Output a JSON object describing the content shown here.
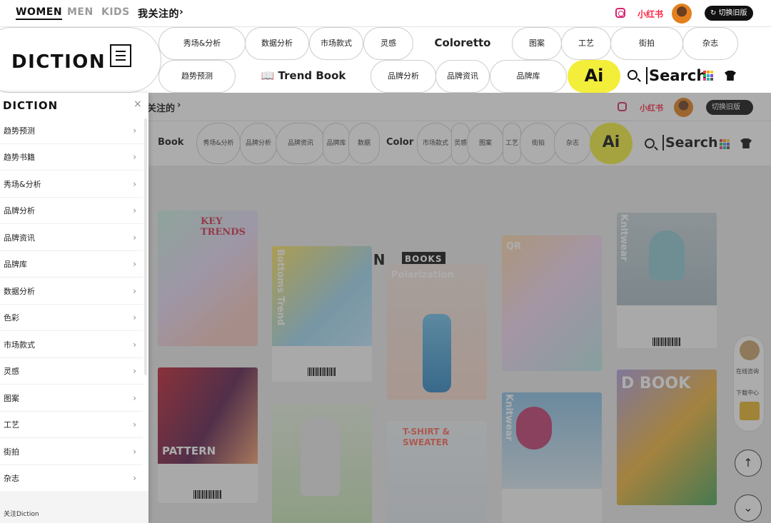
{
  "topbar": {
    "nav": [
      "WOMEN",
      "MEN",
      "KIDS"
    ],
    "following": "我关注的",
    "xiaohongshu": "小红书",
    "old_version": "切换旧版"
  },
  "header": {
    "logo": "DICTION",
    "pills_row1": [
      "秀场&分析",
      "数据分析",
      "市场款式",
      "灵感",
      "图案",
      "工艺",
      "街拍",
      "杂志"
    ],
    "coloretto": "Coloretto",
    "pills_row2": [
      "趋势预测",
      "品牌分析",
      "品牌资讯",
      "品牌库"
    ],
    "trend_book": "Trend Book",
    "ai_label": "Ai",
    "search": "Search"
  },
  "background_page": {
    "following": "关注的",
    "xiaohongshu": "小红书",
    "old_version": "切换旧版",
    "nav_book": "Book",
    "nav_pills": [
      "秀场&分析",
      "品牌分析",
      "品牌资讯",
      "品牌库",
      "数据"
    ],
    "color": "Color",
    "nav_pills2": [
      "市场款式",
      "灵感",
      "图案",
      "工艺",
      "街拍",
      "杂志"
    ],
    "ai_label": "Ai",
    "search": "Search",
    "books_title": "DICTION",
    "books_badge": "BOOKS",
    "books": [
      {
        "title": "KEY TRENDS"
      },
      {
        "title": "Bottoms Trend"
      },
      {
        "title": "Polarization"
      },
      {
        "title": "QR"
      },
      {
        "title": "Knitwear"
      },
      {
        "title": "PATTERN"
      },
      {
        "title": ""
      },
      {
        "title": "T-SHIRT & SWEATER"
      },
      {
        "title": "Knitwear"
      },
      {
        "title": "D BOOK"
      }
    ],
    "float": {
      "consult": "在线咨询",
      "download": "下载中心"
    }
  },
  "drawer": {
    "logo": "DICTION",
    "close": "×",
    "items": [
      "趋势预测",
      "趋势书籍",
      "秀场&分析",
      "品牌分析",
      "品牌资讯",
      "品牌库",
      "数据分析",
      "色彩",
      "市场款式",
      "灵感",
      "图案",
      "工艺",
      "街拍",
      "杂志"
    ],
    "follow": "关注Diction"
  }
}
